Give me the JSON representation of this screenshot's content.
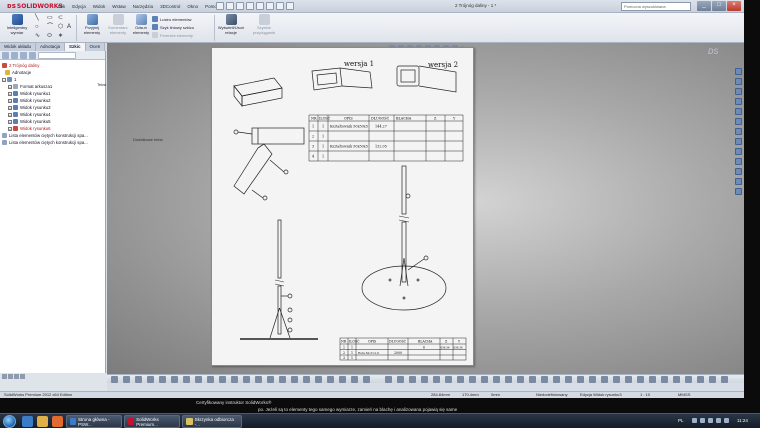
{
  "titlebar": {
    "app_name": "SOLIDWORKS",
    "menu": [
      "Plik",
      "Edycja",
      "Widok",
      "Wstaw",
      "Narzędzia",
      "3DControl",
      "Okno",
      "Pomoc"
    ],
    "document_title": "2 Trójnóg daliny - 1 *",
    "search_placeholder": "Pomocna wyszukiwana",
    "window_controls": [
      "_",
      "□",
      "×"
    ]
  },
  "ribbon": {
    "smart_dimension": "Inteligentny wymiar",
    "model_items": "Przyjmij elementy",
    "comment_items": "Komentarz elementy",
    "offset_items": "Odsuń elementy",
    "entity_list": [
      "Lustro elementów",
      "Szyk liniowy szkicu",
      "Przenieś elementy"
    ],
    "display_relations": "Wyświetl/Usuń relacje",
    "quick_snaps": "Szybkie przyciąganie"
  },
  "cm_tabs": [
    "Widok układu",
    "Adnotacja",
    "Szkic",
    "Ocen"
  ],
  "cm_active_tab": "Szkic",
  "feature_tree": [
    {
      "label": "2 Trójnóg daliny",
      "red": true
    },
    {
      "label": "Adnotacje",
      "red": false
    },
    {
      "label": "1",
      "red": false
    },
    {
      "label": "Format arkusza1",
      "red": false
    },
    {
      "label": "Widok rysunku1",
      "red": false
    },
    {
      "label": "Widok rysunku2",
      "red": false
    },
    {
      "label": "Widok rysunku3",
      "red": false
    },
    {
      "label": "Widok rysunku4",
      "red": false
    },
    {
      "label": "Widok rysunku5",
      "red": false
    },
    {
      "label": "Widok rysunku6",
      "red": true
    },
    {
      "label": "Lista elementów ciętych konstrukcji spa...",
      "red": false
    },
    {
      "label": "Lista elementów ciętych konstrukcji spa...",
      "red": false
    }
  ],
  "canvas": {
    "float_label_1": "Tekst",
    "float_label_2": "Dodatkowe tekst",
    "heads_up_extra": "4z"
  },
  "drawing": {
    "variant1": "wersja 1",
    "variant2": "wersja 2",
    "table1": {
      "headers": [
        "NR",
        "ILOŚĆ",
        "OPIS",
        "DŁUGOŚĆ",
        "BLACHA",
        "Z",
        "Y"
      ],
      "rows": [
        [
          "1",
          "1",
          "Kształtownik 50x50x5",
          "144.27",
          "",
          "",
          ""
        ],
        [
          "2",
          "1",
          "",
          "",
          "",
          "",
          ""
        ],
        [
          "3",
          "1",
          "Kształtownik 50x50x5",
          "132.05",
          "",
          "",
          ""
        ],
        [
          "4",
          "1",
          "",
          "",
          "",
          "",
          ""
        ]
      ]
    },
    "table2": {
      "headers": [
        "NR",
        "ILOŚĆ",
        "OPIS",
        "DŁUGOŚĆ",
        "BLACHA",
        "Z",
        "Y"
      ],
      "rows": [
        [
          "1",
          "1",
          "",
          "",
          "6",
          "836.36",
          "836.36"
        ],
        [
          "2",
          "1",
          "Rura 60,3×2,9",
          "2000",
          "",
          "",
          ""
        ],
        [
          "3",
          "1",
          "",
          "",
          "",
          "",
          ""
        ]
      ]
    }
  },
  "status": {
    "edition": "SolidWorks Premium 2012 x64 Edition",
    "x": "284.84mm",
    "y": "170.4mm",
    "z": "0mm",
    "state": "Niedodefiniowany",
    "editing": "Edycja Widok rysunku3",
    "scale": "1 : 10",
    "units": "MMGS"
  },
  "desktop": {
    "line1": "Certyfikowany instruktor SolidWorks®",
    "line2": "po. Jeżeli są to elementy tego samego wymiarze, zamień na blachę i analizowana pojawią się same"
  },
  "taskbar": {
    "tasks": [
      "Strona główna - PSW...",
      "SolidWorks Premium...",
      "Skrzynka odbiorcza -..."
    ],
    "lang": "PL",
    "clock": "11:24"
  }
}
